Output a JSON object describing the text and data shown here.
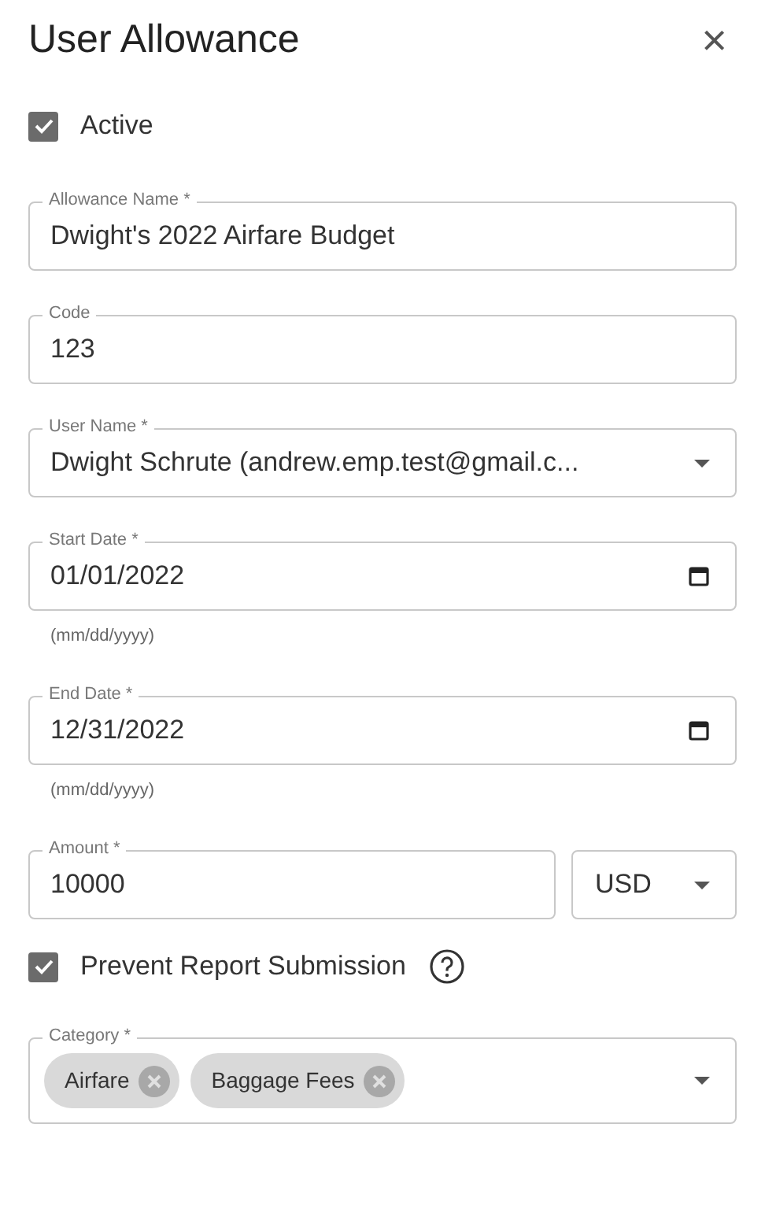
{
  "dialog": {
    "title": "User Allowance",
    "close": "×"
  },
  "items": [
    {
      "kind": "checkbox",
      "label": "Active",
      "checked": true
    },
    {
      "kind": "text",
      "label": "Allowance Name *",
      "value": "Dwight's 2022 Airfare Budget"
    },
    {
      "kind": "text",
      "label": "Code",
      "value": "123"
    },
    {
      "kind": "select",
      "label": "User Name *",
      "value": "Dwight Schrute (andrew.emp.test@gmail.c..."
    },
    {
      "kind": "date",
      "label": "Start Date *",
      "value": "01/01/2022",
      "helper": "(mm/dd/yyyy)"
    },
    {
      "kind": "date",
      "label": "End Date *",
      "value": "12/31/2022",
      "helper": "(mm/dd/yyyy)"
    },
    {
      "kind": "amount",
      "label": "Amount *",
      "value": "10000",
      "currency": "USD"
    },
    {
      "kind": "checkbox",
      "label": "Prevent Report Submission",
      "checked": true,
      "help": true
    },
    {
      "kind": "chips",
      "label": "Category *",
      "chips": [
        "Airfare",
        "Baggage Fees"
      ]
    }
  ]
}
